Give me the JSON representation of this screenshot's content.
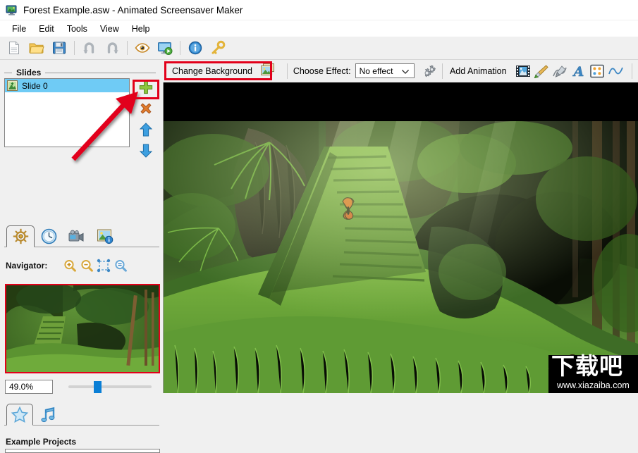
{
  "window": {
    "title": "Forest Example.asw - Animated Screensaver Maker",
    "icon": "app-monitor-icon"
  },
  "menubar": {
    "items": [
      {
        "label": "File"
      },
      {
        "label": "Edit"
      },
      {
        "label": "Tools"
      },
      {
        "label": "View"
      },
      {
        "label": "Help"
      }
    ]
  },
  "toolbar": {
    "buttons": [
      {
        "name": "new-file-icon"
      },
      {
        "name": "open-folder-icon"
      },
      {
        "name": "save-disk-icon"
      },
      {
        "name": "undo-icon"
      },
      {
        "name": "redo-icon"
      },
      {
        "name": "preview-eye-icon"
      },
      {
        "name": "run-screensaver-icon"
      },
      {
        "name": "info-icon"
      },
      {
        "name": "key-icon"
      }
    ]
  },
  "slides_panel": {
    "group_title": "Slides",
    "items": [
      {
        "label": "Slide 0",
        "icon": "slide-image-icon",
        "selected": true
      }
    ],
    "side_buttons": [
      {
        "name": "add-slide-button",
        "icon": "plus-icon",
        "highlighted": true
      },
      {
        "name": "delete-slide-button",
        "icon": "cross-delete-icon"
      },
      {
        "name": "move-slide-up-button",
        "icon": "arrow-up-icon"
      },
      {
        "name": "move-slide-down-button",
        "icon": "arrow-down-icon"
      }
    ],
    "tabs": [
      {
        "name": "tab-scene",
        "icon": "ship-wheel-icon",
        "selected": true
      },
      {
        "name": "tab-timing",
        "icon": "clock-icon",
        "selected": false
      },
      {
        "name": "tab-video",
        "icon": "camcorder-icon",
        "selected": false
      },
      {
        "name": "tab-image-info",
        "icon": "image-info-icon",
        "selected": false
      }
    ]
  },
  "navigator": {
    "label": "Navigator:",
    "buttons": [
      {
        "name": "zoom-in-button",
        "icon": "magnifier-plus-icon"
      },
      {
        "name": "zoom-out-button",
        "icon": "magnifier-minus-icon"
      },
      {
        "name": "fit-to-window-button",
        "icon": "fit-frame-icon"
      },
      {
        "name": "actual-size-button",
        "icon": "magnifier-equal-icon"
      }
    ],
    "zoom_value": "49.0%",
    "slider_percent": 30
  },
  "bottom_panel": {
    "tabs": [
      {
        "name": "tab-examples",
        "icon": "star-icon",
        "selected": true
      },
      {
        "name": "tab-music",
        "icon": "music-note-icon",
        "selected": false
      }
    ],
    "section_title": "Example Projects"
  },
  "effect_bar": {
    "change_background_label": "Change Background",
    "change_background_icon": "change-background-icon",
    "choose_effect_label": "Choose Effect:",
    "effect_value": "No effect",
    "effect_options": [
      "No effect"
    ],
    "effect_settings_icon": "gears-icon",
    "add_animation_label": "Add Animation",
    "animation_buttons": [
      {
        "name": "add-video-animation-button",
        "icon": "filmstrip-image-icon"
      },
      {
        "name": "add-brush-animation-button",
        "icon": "paintbrush-icon"
      },
      {
        "name": "add-path-animation-button",
        "icon": "pen-path-icon"
      },
      {
        "name": "add-text-animation-button",
        "icon": "text-a-icon"
      },
      {
        "name": "add-particles-animation-button",
        "icon": "particles-icon"
      },
      {
        "name": "add-wave-animation-button",
        "icon": "wave-icon"
      }
    ]
  },
  "canvas": {
    "name": "preview-canvas",
    "scene_description": "Forest scene with mossy stone staircase and butterflies",
    "letterbox_color": "#000000"
  },
  "watermark": {
    "text_cn": "下载吧",
    "url": "www.xiazaiba.com"
  },
  "annotations": {
    "highlight_color": "#e2001a",
    "arrow_from": "add-slide-button",
    "arrow_to": "slides-list"
  }
}
